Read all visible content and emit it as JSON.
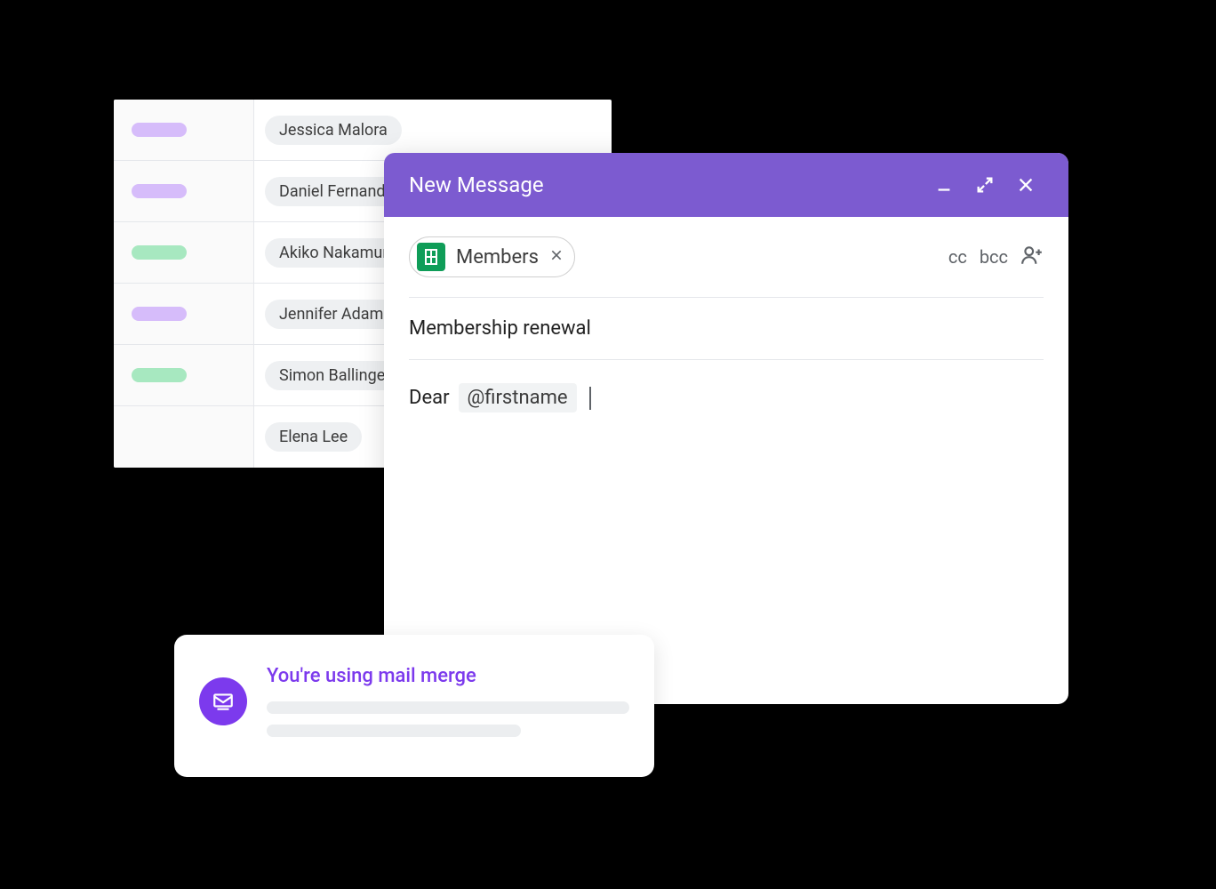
{
  "sheet": {
    "rows": [
      {
        "status_color": "purple",
        "name": "Jessica Malora"
      },
      {
        "status_color": "purple",
        "name": "Daniel Fernandez"
      },
      {
        "status_color": "green",
        "name": "Akiko Nakamura"
      },
      {
        "status_color": "purple",
        "name": "Jennifer Adams"
      },
      {
        "status_color": "green",
        "name": "Simon Ballinger"
      },
      {
        "status_color": "",
        "name": "Elena Lee"
      }
    ]
  },
  "compose": {
    "title": "New Message",
    "recipient_chip_label": "Members",
    "cc_label": "cc",
    "bcc_label": "bcc",
    "subject": "Membership renewal",
    "body_greeting": "Dear",
    "merge_tag": "@firstname"
  },
  "info_card": {
    "title": "You're using mail merge"
  },
  "colors": {
    "accent_purple": "#7c5bd0",
    "badge_purple": "#d6bcfa",
    "badge_green": "#a7e8c0",
    "sheets_green": "#0f9d58",
    "mail_merge_purple": "#7c3aed"
  }
}
